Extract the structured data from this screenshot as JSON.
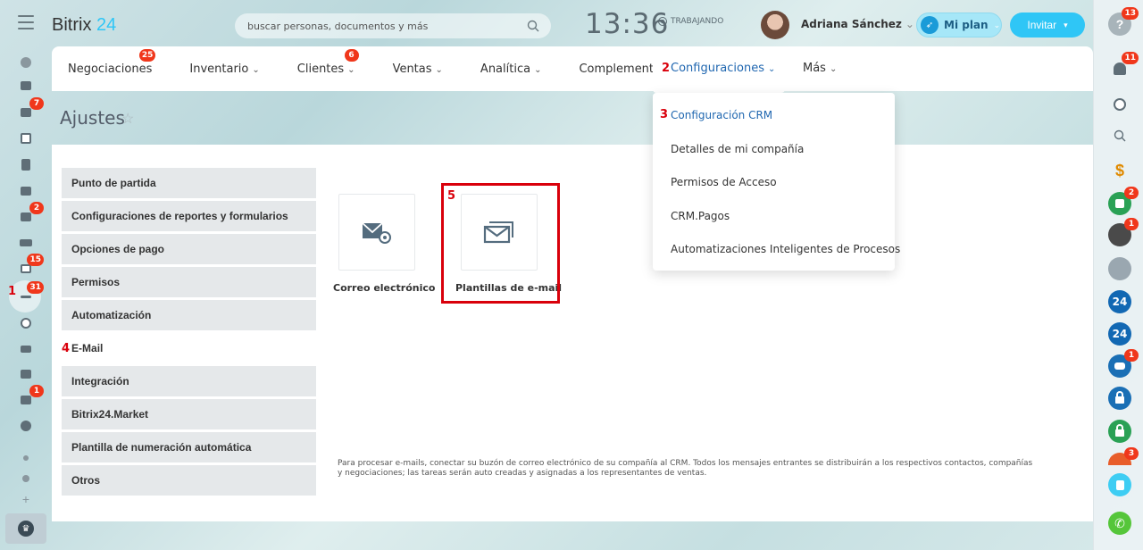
{
  "header": {
    "logo_text": "Bitrix",
    "logo_number": "24",
    "search_placeholder": "buscar personas, documentos y más",
    "clock": "13:36",
    "work_status": "TRABAJANDO",
    "user_name": "Adriana Sánchez",
    "plan_label": "Mi plan",
    "invite_label": "Invitar"
  },
  "left_rail": {
    "badges": {
      "messages": "7",
      "mail": "2",
      "tasks": "15",
      "crm": "31",
      "bot": "1"
    },
    "annotation_1": "1"
  },
  "crm_menu": {
    "items": [
      {
        "label": "Negociaciones",
        "badge": "25"
      },
      {
        "label": "Inventario",
        "chevron": "⌄"
      },
      {
        "label": "Clientes",
        "badge": "6",
        "chevron": "⌄"
      },
      {
        "label": "Ventas",
        "chevron": "⌄"
      },
      {
        "label": "Analítica",
        "chevron": "⌄"
      },
      {
        "label": "Complementos",
        "chevron": "⌄"
      },
      {
        "label": "Configuraciones",
        "chevron": "⌄",
        "annotation": "2"
      },
      {
        "label": "Más",
        "chevron": "⌄"
      }
    ]
  },
  "page": {
    "title": "Ajustes",
    "star": "☆"
  },
  "nav": {
    "items": [
      "Punto de partida",
      "Configuraciones de reportes y formularios",
      "Opciones de pago",
      "Permisos",
      "Automatización",
      "E-Mail",
      "Integración",
      "Bitrix24.Market",
      "Plantilla de numeración automática",
      "Otros"
    ],
    "annotation_4": "4"
  },
  "tiles": {
    "email_label": "Correo electrónico",
    "templates_label": "Plantillas de e-mail",
    "annotation_5": "5"
  },
  "help_text": "Para procesar e-mails, conectar su buzón de correo electrónico de su compañía al CRM. Todos los mensajes entrantes se distribuirán a los respectivos contactos, compañías y negociaciones; las tareas serán auto creadas y asignadas a los representantes de ventas.",
  "dropdown": {
    "annotation_3": "3",
    "items": [
      "Configuración CRM",
      "Detalles de mi compañía",
      "Permisos de Acceso",
      "CRM.Pagos",
      "Automatizaciones Inteligentes de Procesos"
    ]
  },
  "right_rail": {
    "help_badge": "13",
    "bell_badge": "11",
    "badge_a": "2",
    "badge_b": "1",
    "badge_c": "1",
    "badge_d": "3",
    "label_24": "24"
  },
  "colors": {
    "accent": "#2fc6f6",
    "link_active": "#2067b0",
    "badge": "#f0371b",
    "annotation": "#d9000b"
  }
}
